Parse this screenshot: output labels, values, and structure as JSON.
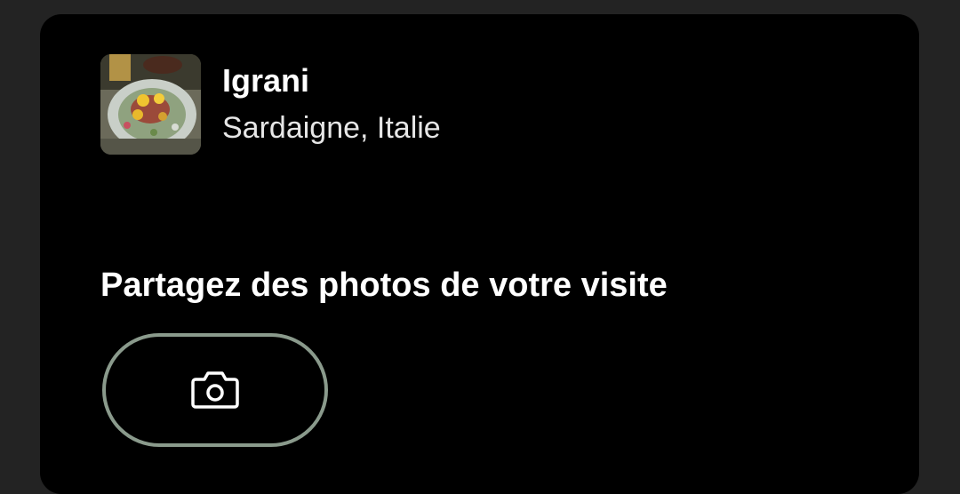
{
  "place": {
    "name": "Igrani",
    "location": "Sardaigne, Italie",
    "thumbnail_icon": "food-plate-photo"
  },
  "share": {
    "title": "Partagez des photos de votre visite",
    "button_icon": "camera-icon"
  },
  "colors": {
    "background": "#232323",
    "card": "#000000",
    "button_border": "#8a9a8c",
    "text_primary": "#ffffff"
  }
}
